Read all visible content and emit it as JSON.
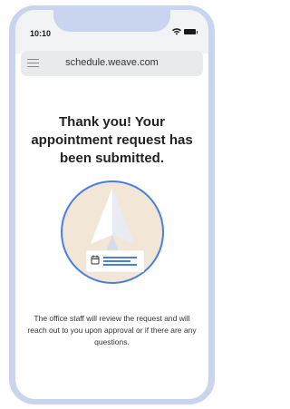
{
  "status_bar": {
    "time": "10:10",
    "icons": [
      "wifi-icon",
      "battery-icon"
    ]
  },
  "browser": {
    "url": "schedule.weave.com",
    "menu_icon": "hamburger-menu-icon"
  },
  "confirmation": {
    "title": "Thank you! Your appointment request has been submitted.",
    "message": "The office staff will review the request and will reach out to you upon approval or if there are any questions.",
    "illustration": "paper-plane-icon",
    "card_icon": "calendar-icon"
  },
  "colors": {
    "frame": "#c9d5ef",
    "accent_blue": "#4a7fe0",
    "illustration_bg": "#f2e6d6"
  }
}
